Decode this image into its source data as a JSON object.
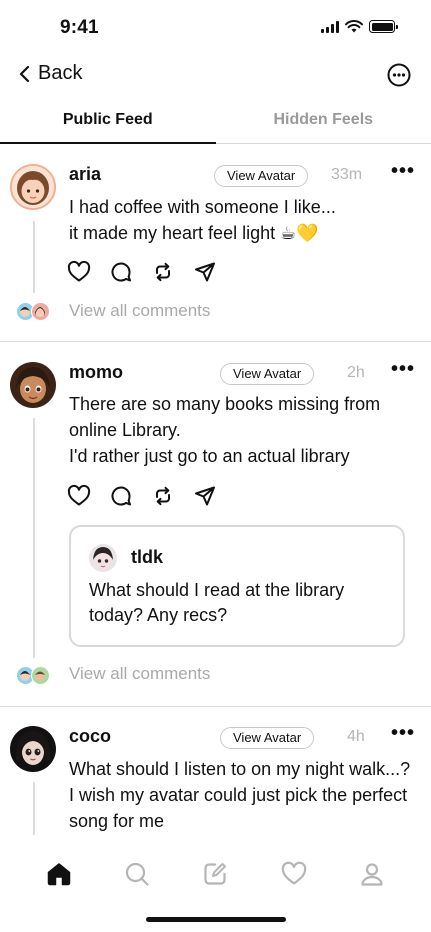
{
  "status_bar": {
    "time": "9:41"
  },
  "nav": {
    "back_label": "Back",
    "more_icon": "more-circle-icon"
  },
  "tabs": [
    {
      "label": "Public Feed",
      "active": true
    },
    {
      "label": "Hidden Feels",
      "active": false
    }
  ],
  "posts": [
    {
      "username": "aria",
      "view_avatar_label": "View Avatar",
      "time": "33m",
      "more": "•••",
      "text": "I had coffee with someone I like...\nit made my heart feel light ☕💛",
      "view_comments": "View all comments"
    },
    {
      "username": "momo",
      "view_avatar_label": "View Avatar",
      "time": "2h",
      "more": "•••",
      "text": "There are so many books missing from online Library.\n I'd rather just go to an actual library",
      "quote": {
        "username": "tldk",
        "text": "What should I read at the library today? Any recs?"
      },
      "view_comments": "View all comments"
    },
    {
      "username": "coco",
      "view_avatar_label": "View Avatar",
      "time": "4h",
      "more": "•••",
      "text": "What should I listen to on my night walk...? I wish my avatar could just pick the perfect song for me"
    }
  ],
  "bottom_nav": [
    "home-icon",
    "search-icon",
    "compose-icon",
    "heart-icon",
    "profile-icon"
  ],
  "colors": {
    "text": "#111111",
    "muted": "#a9a9a9",
    "divider": "#dcdcdc"
  }
}
